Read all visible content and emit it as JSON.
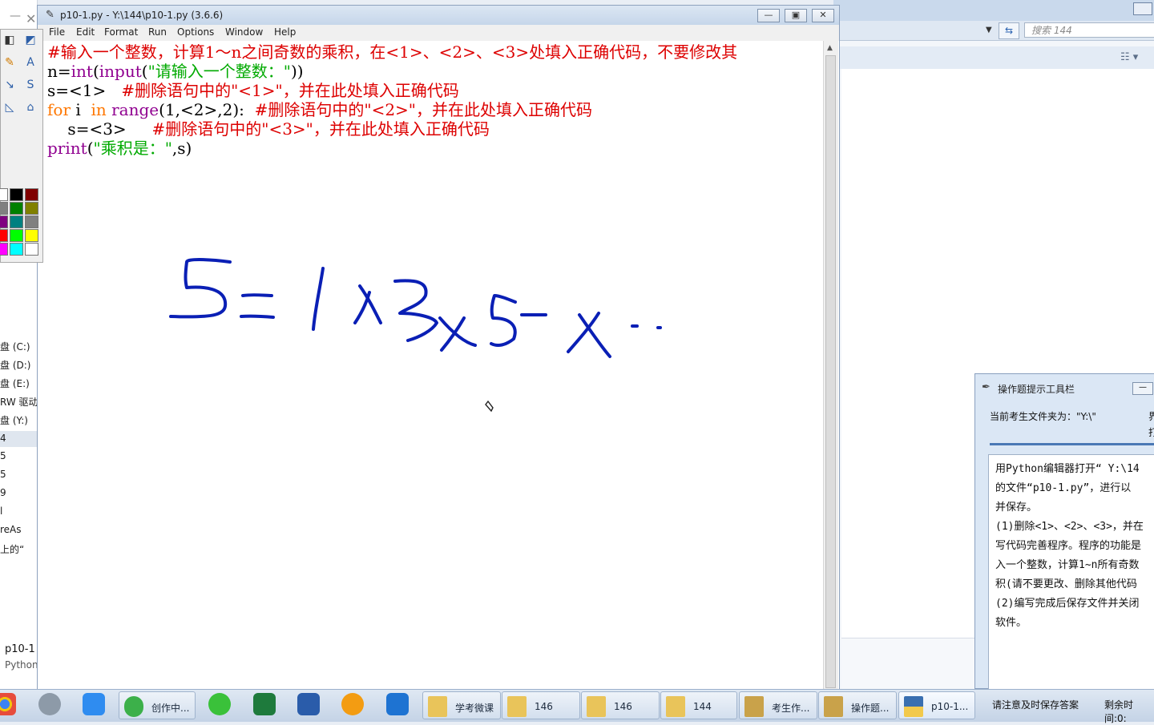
{
  "editor": {
    "title": "p10-1.py - Y:\\144\\p10-1.py (3.6.6)",
    "menu": [
      "File",
      "Edit",
      "Format",
      "Run",
      "Options",
      "Window",
      "Help"
    ],
    "code": {
      "line1": "#输入一个整数，计算1～n之间奇数的乘积，在<1>、<2>、<3>处填入正确代码，不要修改其",
      "line2_a": "n=",
      "line2_b": "int",
      "line2_c": "(",
      "line2_d": "input",
      "line2_e": "(",
      "line2_f": "\"请输入一个整数：\"",
      "line2_g": "))",
      "line3_a": "s=<1>   ",
      "line3_b": "#删除语句中的\"<1>\"，并在此处填入正确代码",
      "line4_a": "for",
      "line4_b": " i  ",
      "line4_c": "in",
      "line4_d": " ",
      "line4_e": "range",
      "line4_f": "(1,<2>,2):  ",
      "line4_g": "#删除语句中的\"<2>\"，并在此处填入正确代码",
      "line5_a": "    s=<3>     ",
      "line5_b": "#删除语句中的\"<3>\"，并在此处填入正确代码",
      "line6_a": "print",
      "line6_b": "(",
      "line6_c": "\"乘积是：\"",
      "line6_d": ",s)"
    }
  },
  "explorer": {
    "search_placeholder": "搜索 144",
    "drives": [
      "盘 (C:)",
      "盘 (D:)",
      "盘 (E:)",
      "RW 驱动",
      "盘 (Y:)"
    ],
    "items": [
      "4",
      "5",
      "5",
      "9",
      "l",
      "reAs",
      "上的“"
    ],
    "bottom_name": "p10-1",
    "bottom_type": "Python"
  },
  "hint_panel": {
    "title": "操作题提示工具栏",
    "folder_label": "当前考生文件夹为：\"Y:\\\"",
    "folder_right1": "界",
    "folder_right2": "打",
    "body_lines": [
      "用Python编辑器打开“ Y:\\14",
      "的文件“p10-1.py”，进行以",
      "并保存。",
      "(1)删除<1>、<2>、<3>，并在",
      "写代码完善程序。程序的功能是",
      "入一个整数，计算1~n所有奇数",
      "积(请不要更改、删除其他代码",
      "(2)编写完成后保存文件并关闭",
      "软件。"
    ]
  },
  "taskbar": {
    "apps": [
      "创作中...",
      "学考微课",
      "146",
      "146",
      "144",
      "考生作...",
      "操作题...",
      "p10-1..."
    ],
    "status_save": "请注意及时保存答案",
    "status_time": "剩余时间:0:"
  },
  "colors": {
    "comment": "#dd0000",
    "builtin": "#900090",
    "string": "#00aa00",
    "keyword": "#ff7700",
    "ink": "#0a1fb5"
  }
}
